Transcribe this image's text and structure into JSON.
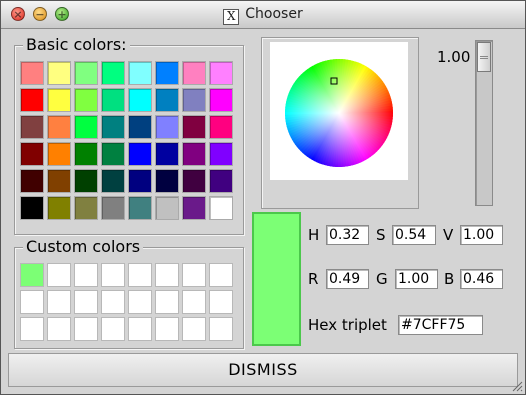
{
  "window": {
    "title": "Chooser",
    "title_icon": "X"
  },
  "basic_colors": {
    "label": "Basic colors:",
    "swatches": [
      "#ff8080",
      "#ffff80",
      "#80ff80",
      "#00ff80",
      "#80ffff",
      "#0080ff",
      "#ff80c0",
      "#ff80ff",
      "#ff0000",
      "#ffff40",
      "#80ff40",
      "#00e080",
      "#00ffff",
      "#0080c0",
      "#8080c0",
      "#ff00ff",
      "#804040",
      "#ff8040",
      "#00ff40",
      "#008080",
      "#004080",
      "#8080ff",
      "#800040",
      "#ff0080",
      "#800000",
      "#ff8000",
      "#008000",
      "#008040",
      "#0000ff",
      "#0000a0",
      "#800080",
      "#8000ff",
      "#400000",
      "#804000",
      "#004000",
      "#004040",
      "#000080",
      "#000040",
      "#400040",
      "#400080",
      "#000000",
      "#808000",
      "#808040",
      "#808080",
      "#408080",
      "#c0c0c0",
      "#6a1a8a",
      "#ffffff"
    ]
  },
  "custom_colors": {
    "label": "Custom colors",
    "swatches": [
      "#7cff75",
      "#ffffff",
      "#ffffff",
      "#ffffff",
      "#ffffff",
      "#ffffff",
      "#ffffff",
      "#ffffff",
      "#ffffff",
      "#ffffff",
      "#ffffff",
      "#ffffff",
      "#ffffff",
      "#ffffff",
      "#ffffff",
      "#ffffff",
      "#ffffff",
      "#ffffff",
      "#ffffff",
      "#ffffff",
      "#ffffff",
      "#ffffff",
      "#ffffff",
      "#ffffff"
    ]
  },
  "value_slider": {
    "label": "1.00",
    "value": 1.0
  },
  "hsv": {
    "h_label": "H",
    "h": "0.32",
    "s_label": "S",
    "s": "0.54",
    "v_label": "V",
    "v": "1.00"
  },
  "rgb": {
    "r_label": "R",
    "r": "0.49",
    "g_label": "G",
    "g": "1.00",
    "b_label": "B",
    "b": "0.46"
  },
  "hex": {
    "label": "Hex triplet",
    "value": "#7CFF75"
  },
  "preview_color": "#7cff75",
  "dismiss": {
    "label": "DISMISS"
  }
}
